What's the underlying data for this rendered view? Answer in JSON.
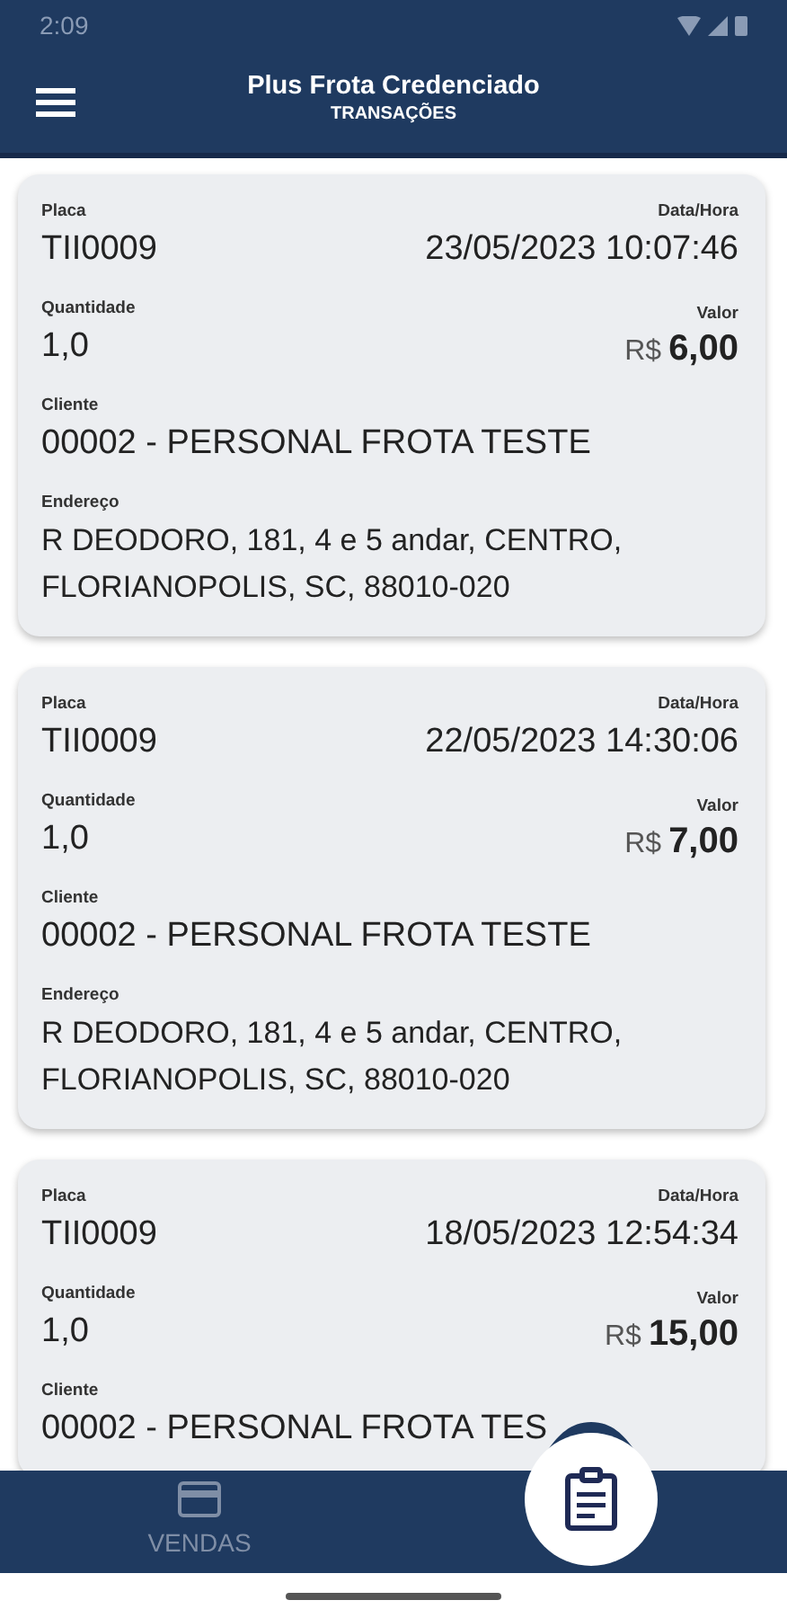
{
  "status_bar": {
    "time": "2:09"
  },
  "header": {
    "title": "Plus Frota Credenciado",
    "subtitle": "TRANSAÇÕES"
  },
  "transactions": [
    {
      "plate_label": "Placa",
      "plate": "TII0009",
      "datetime_label": "Data/Hora",
      "datetime": "23/05/2023 10:07:46",
      "quantity_label": "Quantidade",
      "quantity": "1,0",
      "value_label": "Valor",
      "currency": "R$",
      "amount": "6,00",
      "client_label": "Cliente",
      "client": "00002 - PERSONAL FROTA TESTE",
      "address_label": "Endereço",
      "address": "R DEODORO, 181, 4 e 5 andar, CENTRO, FLORIANOPOLIS, SC, 88010-020"
    },
    {
      "plate_label": "Placa",
      "plate": "TII0009",
      "datetime_label": "Data/Hora",
      "datetime": "22/05/2023 14:30:06",
      "quantity_label": "Quantidade",
      "quantity": "1,0",
      "value_label": "Valor",
      "currency": "R$",
      "amount": "7,00",
      "client_label": "Cliente",
      "client": "00002 - PERSONAL FROTA TESTE",
      "address_label": "Endereço",
      "address": "R DEODORO, 181, 4 e 5 andar, CENTRO, FLORIANOPOLIS, SC, 88010-020"
    },
    {
      "plate_label": "Placa",
      "plate": "TII0009",
      "datetime_label": "Data/Hora",
      "datetime": "18/05/2023 12:54:34",
      "quantity_label": "Quantidade",
      "quantity": "1,0",
      "value_label": "Valor",
      "currency": "R$",
      "amount": "15,00",
      "client_label": "Cliente",
      "client": "00002 - PERSONAL FROTA TES"
    }
  ],
  "bottom_nav": {
    "items": [
      {
        "label": "VENDAS",
        "selected": false
      }
    ]
  }
}
